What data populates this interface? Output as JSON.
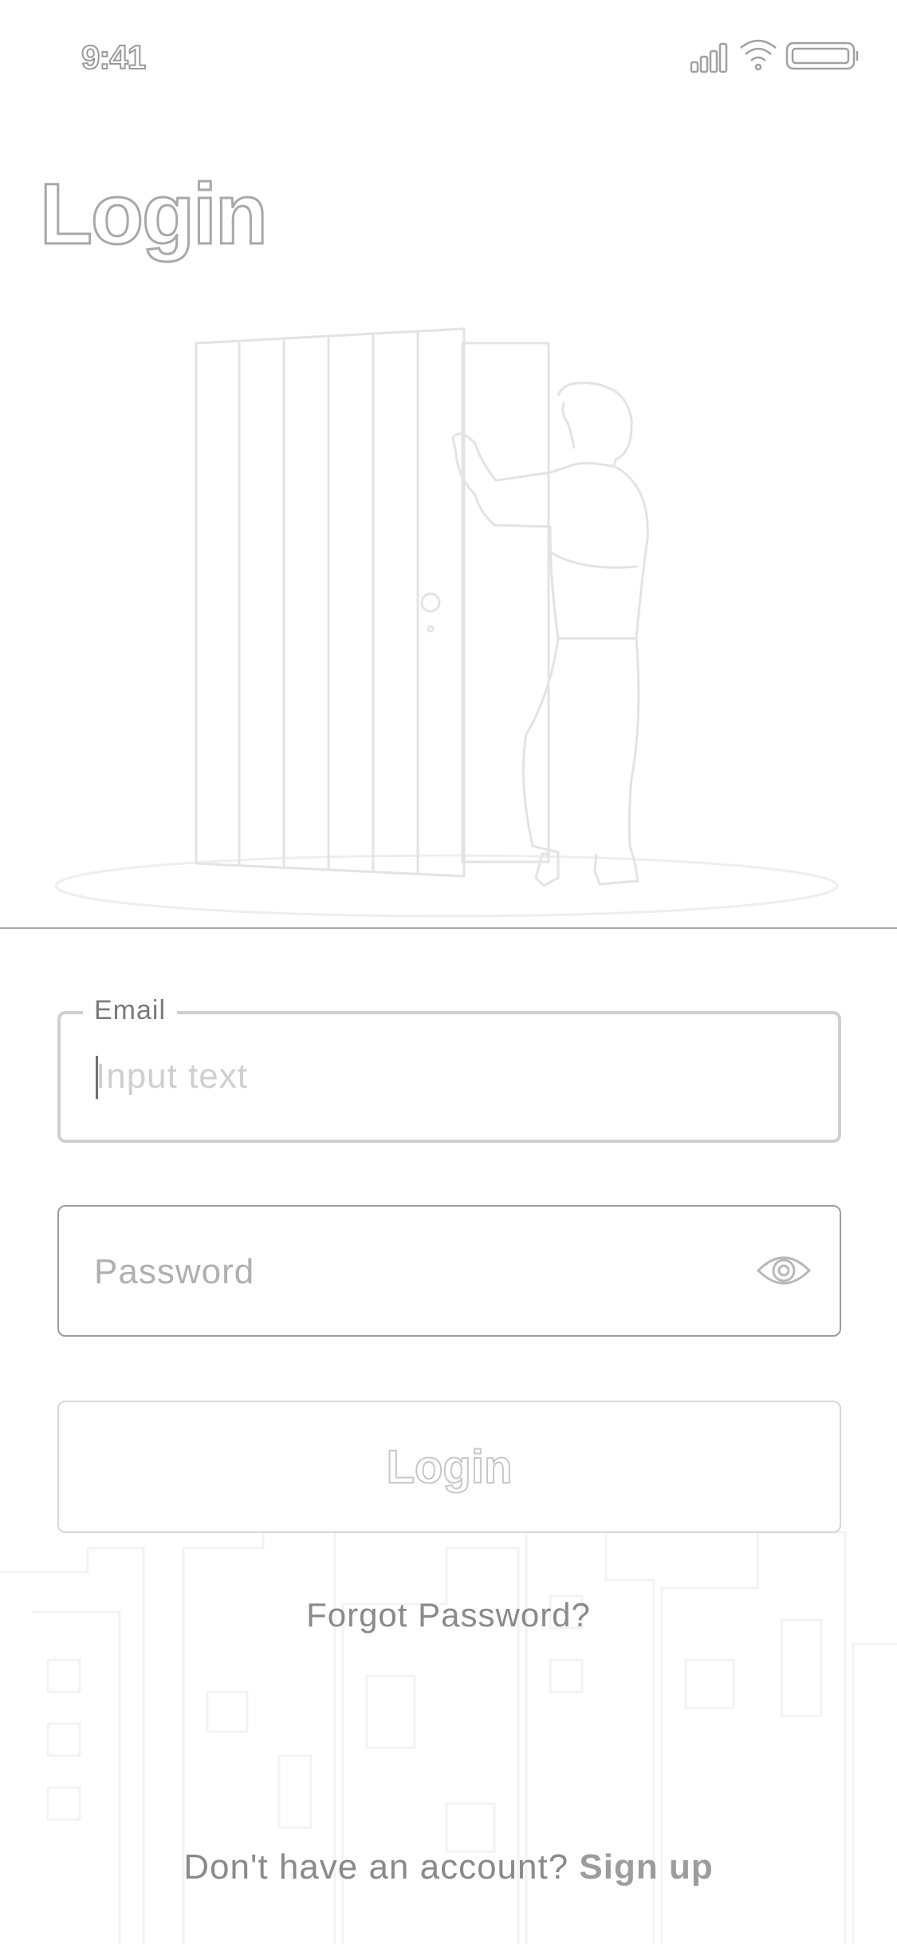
{
  "status_bar": {
    "time": "9:41",
    "icons": [
      "cellular-signal-icon",
      "wifi-icon",
      "battery-icon"
    ]
  },
  "page": {
    "title": "Login",
    "illustration": "person-opening-door-illustration"
  },
  "form": {
    "email": {
      "label": "Email",
      "placeholder": "Input text",
      "value": ""
    },
    "password": {
      "placeholder": "Password",
      "value": "",
      "toggle_icon": "eye-icon"
    },
    "login_button_label": "Login",
    "forgot_password_label": "Forgot Password?"
  },
  "footer": {
    "prompt": "Don't have an account?",
    "signup_label": "Sign up"
  },
  "colors": {
    "background": "#ffffff",
    "text": "#8a8a8a",
    "outline": "#a8a8a8",
    "field_border_focused": "#cfcfcf",
    "field_border": "#9c9c9c"
  }
}
